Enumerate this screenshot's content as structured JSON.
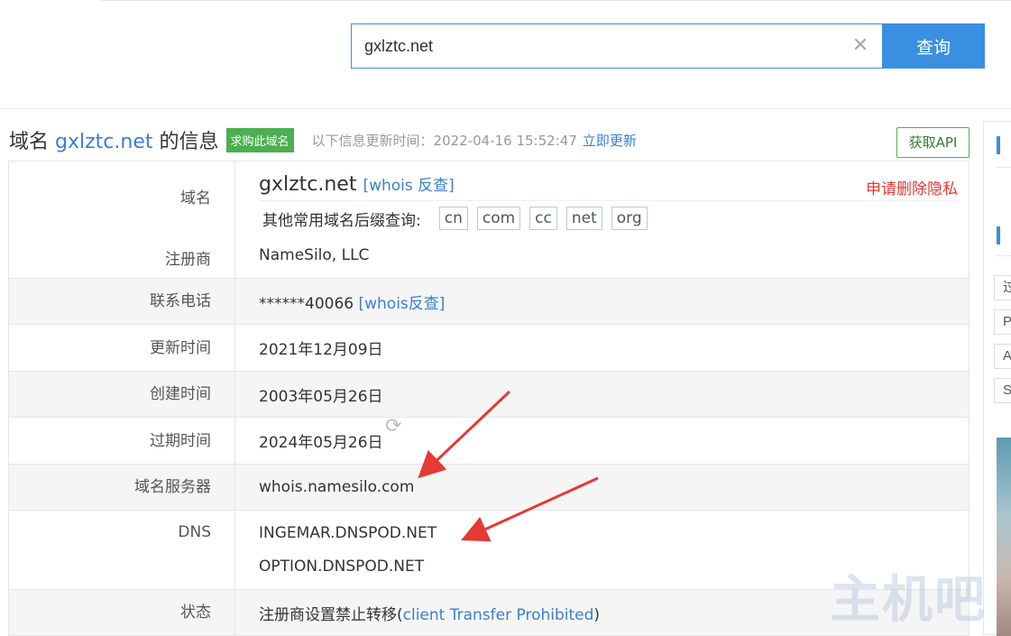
{
  "search": {
    "value": "gxlztc.net",
    "button": "查询"
  },
  "header": {
    "title_prefix": "域名",
    "title_domain": "gxlztc.net",
    "title_suffix": "的信息",
    "buy_badge": "求购此域名",
    "update_label": "以下信息更新时间：",
    "update_time": "2022-04-16 15:52:47",
    "update_link": "立即更新",
    "api_button": "获取API"
  },
  "rows": {
    "domain": {
      "label": "域名",
      "value": "gxlztc.net",
      "whois_link": "[whois 反查]",
      "privacy_link": "申请删除隐私",
      "suffix_label": "其他常用域名后缀查询:",
      "suffixes": [
        "cn",
        "com",
        "cc",
        "net",
        "org"
      ]
    },
    "registrar": {
      "label": "注册商",
      "value": "NameSilo, LLC"
    },
    "phone": {
      "label": "联系电话",
      "value": "******40066",
      "link": "[whois反查]"
    },
    "updated": {
      "label": "更新时间",
      "value": "2021年12月09日"
    },
    "created": {
      "label": "创建时间",
      "value": "2003年05月26日"
    },
    "expires": {
      "label": "过期时间",
      "value": "2024年05月26日"
    },
    "whois_server": {
      "label": "域名服务器",
      "value": "whois.namesilo.com"
    },
    "dns": {
      "label": "DNS",
      "values": [
        "INGEMAR.DNSPOD.NET",
        "OPTION.DNSPOD.NET"
      ]
    },
    "status": {
      "label": "状态",
      "value_prefix": "注册商设置禁止转移(",
      "value_link": "client Transfer Prohibited",
      "value_suffix": ")"
    }
  },
  "sidebar": {
    "items": [
      "过",
      "P",
      "A",
      "S"
    ]
  },
  "watermark": "主机吧",
  "colors": {
    "accent": "#3b8fe0",
    "link": "#3b7fd0",
    "badge": "#4caf50",
    "arrow": "#e53935"
  }
}
